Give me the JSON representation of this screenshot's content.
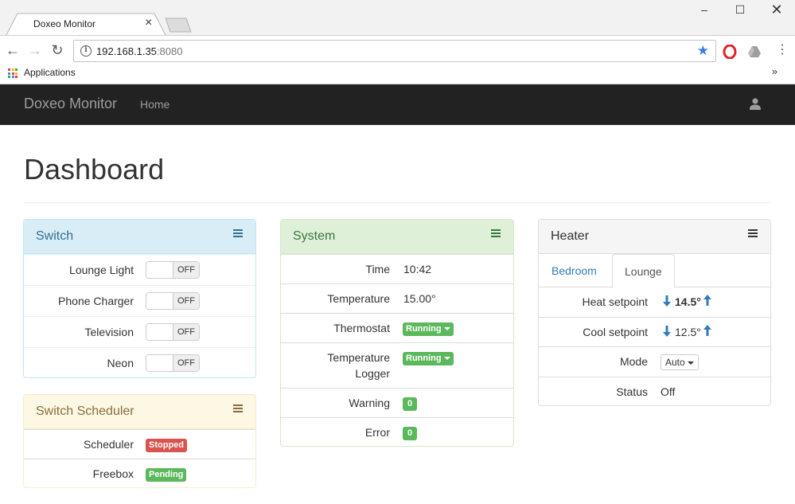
{
  "browser": {
    "tab_title": "Doxeo Monitor",
    "url_host": "192.168.1.35",
    "url_port": ":8080",
    "bookmark_apps": "Applications"
  },
  "navbar": {
    "brand": "Doxeo Monitor",
    "home": "Home"
  },
  "page": {
    "title": "Dashboard"
  },
  "switch_panel": {
    "title": "Switch",
    "items": [
      {
        "label": "Lounge Light",
        "state": "OFF"
      },
      {
        "label": "Phone Charger",
        "state": "OFF"
      },
      {
        "label": "Television",
        "state": "OFF"
      },
      {
        "label": "Neon",
        "state": "OFF"
      }
    ]
  },
  "scheduler_panel": {
    "title": "Switch Scheduler",
    "items": [
      {
        "label": "Scheduler",
        "status": "Stopped",
        "color": "#d9534f"
      },
      {
        "label": "Freebox",
        "status": "Pending",
        "color": "#5cb85c"
      }
    ]
  },
  "system_panel": {
    "title": "System",
    "rows": {
      "time": {
        "label": "Time",
        "value": "10:42"
      },
      "temperature": {
        "label": "Temperature",
        "value": "15.00°"
      },
      "thermostat": {
        "label": "Thermostat",
        "value": "Running"
      },
      "temp_logger": {
        "label_line1": "Temperature",
        "label_line2": "Logger",
        "value": "Running"
      },
      "warning": {
        "label": "Warning",
        "value": "0"
      },
      "error": {
        "label": "Error",
        "value": "0"
      }
    }
  },
  "heater_panel": {
    "title": "Heater",
    "tabs": [
      {
        "label": "Bedroom",
        "active": false
      },
      {
        "label": "Lounge",
        "active": true
      }
    ],
    "heat_setpoint": {
      "label": "Heat setpoint",
      "value": "14.5°"
    },
    "cool_setpoint": {
      "label": "Cool setpoint",
      "value": "12.5°"
    },
    "mode": {
      "label": "Mode",
      "value": "Auto"
    },
    "status": {
      "label": "Status",
      "value": "Off"
    }
  },
  "colors": {
    "navbar_bg": "#222222",
    "info_heading": "#d9edf7",
    "success_heading": "#dff0d8",
    "warning_heading": "#fcf8e3",
    "default_heading": "#f5f5f5",
    "label_green": "#5cb85c",
    "label_red": "#d9534f",
    "link_blue": "#337ab7"
  }
}
